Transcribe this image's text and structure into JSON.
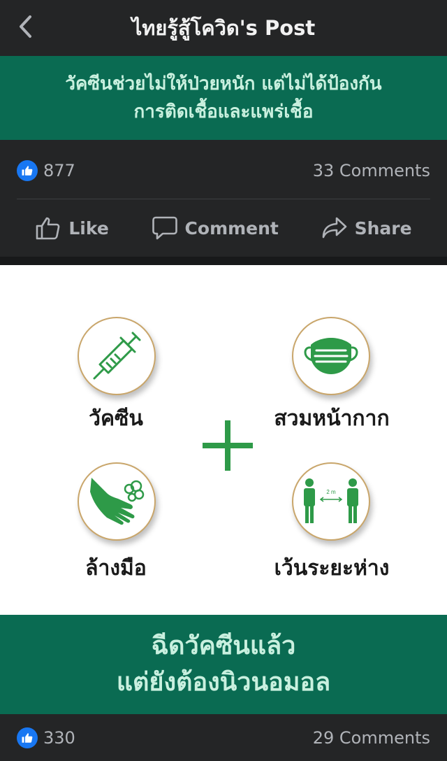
{
  "header": {
    "title": "ไทยรู้สู้โควิด's Post"
  },
  "banner_top": {
    "line1": "วัคซีนช่วยไม่ให้ป่วยหนัก แต่ไม่ได้ป้องกัน",
    "line2": "การติดเชื้อและแพร่เชื้อ"
  },
  "post1": {
    "likes": "877",
    "comments": "33 Comments"
  },
  "actions": {
    "like": "Like",
    "comment": "Comment",
    "share": "Share"
  },
  "infographic": {
    "items": [
      {
        "label": "วัคซีน",
        "icon": "syringe-icon"
      },
      {
        "label": "สวมหน้ากาก",
        "icon": "face-mask-icon"
      },
      {
        "label": "ล้างมือ",
        "icon": "hand-wash-icon"
      },
      {
        "label": "เว้นระยะห่าง",
        "icon": "distancing-icon"
      }
    ],
    "distance_text": "2 m"
  },
  "banner_bottom": {
    "line1": "ฉีดวัคซีนแล้ว",
    "line2": "แต่ยังต้องนิวนอมอล"
  },
  "post2": {
    "likes": "330",
    "comments": "29 Comments"
  },
  "colors": {
    "banner_green": "#0a6b52",
    "banner_text": "#c9f0df",
    "icon_green": "#2e9a48",
    "like_blue": "#1877f2"
  }
}
